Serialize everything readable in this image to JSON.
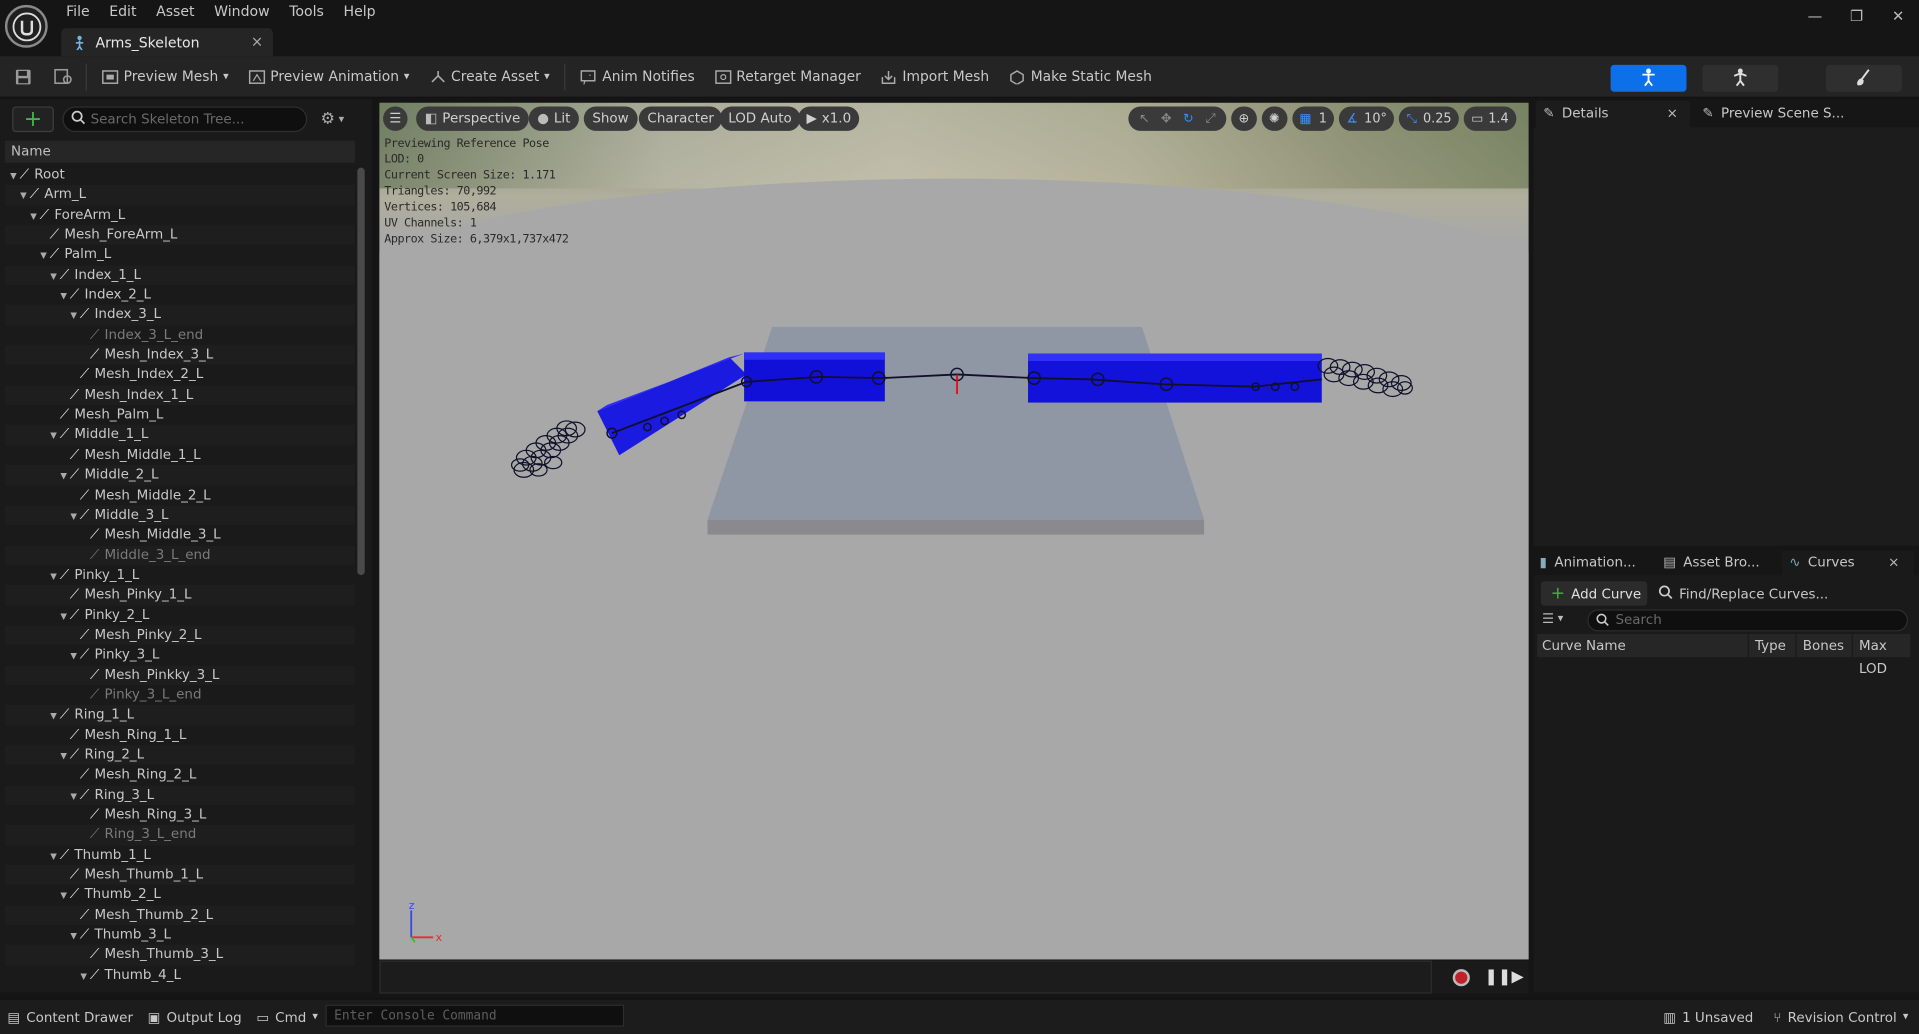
{
  "menu": [
    "File",
    "Edit",
    "Asset",
    "Window",
    "Tools",
    "Help"
  ],
  "document_tab": {
    "title": "Arms_Skeleton",
    "close": "×"
  },
  "window_controls": {
    "minimize": "—",
    "restore": "❐",
    "close": "✕"
  },
  "toolbar": {
    "preview_mesh": "Preview Mesh",
    "preview_animation": "Preview Animation",
    "create_asset": "Create Asset",
    "anim_notifies": "Anim Notifies",
    "retarget_manager": "Retarget Manager",
    "import_mesh": "Import Mesh",
    "make_static_mesh": "Make Static Mesh"
  },
  "skeleton_tree": {
    "search_placeholder": "Search Skeleton Tree...",
    "column_name": "Name",
    "bones": [
      {
        "label": "Root",
        "depth": 0,
        "expand": true,
        "dim": false
      },
      {
        "label": "Arm_L",
        "depth": 1,
        "expand": true,
        "dim": false
      },
      {
        "label": "ForeArm_L",
        "depth": 2,
        "expand": true,
        "dim": false
      },
      {
        "label": "Mesh_ForeArm_L",
        "depth": 3,
        "expand": false,
        "dim": false
      },
      {
        "label": "Palm_L",
        "depth": 3,
        "expand": true,
        "dim": false
      },
      {
        "label": "Index_1_L",
        "depth": 4,
        "expand": true,
        "dim": false
      },
      {
        "label": "Index_2_L",
        "depth": 5,
        "expand": true,
        "dim": false
      },
      {
        "label": "Index_3_L",
        "depth": 6,
        "expand": true,
        "dim": false
      },
      {
        "label": "Index_3_L_end",
        "depth": 7,
        "expand": false,
        "dim": true
      },
      {
        "label": "Mesh_Index_3_L",
        "depth": 7,
        "expand": false,
        "dim": false
      },
      {
        "label": "Mesh_Index_2_L",
        "depth": 6,
        "expand": false,
        "dim": false
      },
      {
        "label": "Mesh_Index_1_L",
        "depth": 5,
        "expand": false,
        "dim": false
      },
      {
        "label": "Mesh_Palm_L",
        "depth": 4,
        "expand": false,
        "dim": false
      },
      {
        "label": "Middle_1_L",
        "depth": 4,
        "expand": true,
        "dim": false
      },
      {
        "label": "Mesh_Middle_1_L",
        "depth": 5,
        "expand": false,
        "dim": false
      },
      {
        "label": "Middle_2_L",
        "depth": 5,
        "expand": true,
        "dim": false
      },
      {
        "label": "Mesh_Middle_2_L",
        "depth": 6,
        "expand": false,
        "dim": false
      },
      {
        "label": "Middle_3_L",
        "depth": 6,
        "expand": true,
        "dim": false
      },
      {
        "label": "Mesh_Middle_3_L",
        "depth": 7,
        "expand": false,
        "dim": false
      },
      {
        "label": "Middle_3_L_end",
        "depth": 7,
        "expand": false,
        "dim": true
      },
      {
        "label": "Pinky_1_L",
        "depth": 4,
        "expand": true,
        "dim": false
      },
      {
        "label": "Mesh_Pinky_1_L",
        "depth": 5,
        "expand": false,
        "dim": false
      },
      {
        "label": "Pinky_2_L",
        "depth": 5,
        "expand": true,
        "dim": false
      },
      {
        "label": "Mesh_Pinky_2_L",
        "depth": 6,
        "expand": false,
        "dim": false
      },
      {
        "label": "Pinky_3_L",
        "depth": 6,
        "expand": true,
        "dim": false
      },
      {
        "label": "Mesh_Pinkky_3_L",
        "depth": 7,
        "expand": false,
        "dim": false
      },
      {
        "label": "Pinky_3_L_end",
        "depth": 7,
        "expand": false,
        "dim": true
      },
      {
        "label": "Ring_1_L",
        "depth": 4,
        "expand": true,
        "dim": false
      },
      {
        "label": "Mesh_Ring_1_L",
        "depth": 5,
        "expand": false,
        "dim": false
      },
      {
        "label": "Ring_2_L",
        "depth": 5,
        "expand": true,
        "dim": false
      },
      {
        "label": "Mesh_Ring_2_L",
        "depth": 6,
        "expand": false,
        "dim": false
      },
      {
        "label": "Ring_3_L",
        "depth": 6,
        "expand": true,
        "dim": false
      },
      {
        "label": "Mesh_Ring_3_L",
        "depth": 7,
        "expand": false,
        "dim": false
      },
      {
        "label": "Ring_3_L_end",
        "depth": 7,
        "expand": false,
        "dim": true
      },
      {
        "label": "Thumb_1_L",
        "depth": 4,
        "expand": true,
        "dim": false
      },
      {
        "label": "Mesh_Thumb_1_L",
        "depth": 5,
        "expand": false,
        "dim": false
      },
      {
        "label": "Thumb_2_L",
        "depth": 5,
        "expand": true,
        "dim": false
      },
      {
        "label": "Mesh_Thumb_2_L",
        "depth": 6,
        "expand": false,
        "dim": false
      },
      {
        "label": "Thumb_3_L",
        "depth": 6,
        "expand": true,
        "dim": false
      },
      {
        "label": "Mesh_Thumb_3_L",
        "depth": 7,
        "expand": false,
        "dim": false
      },
      {
        "label": "Thumb_4_L",
        "depth": 7,
        "expand": true,
        "dim": false
      }
    ]
  },
  "viewport": {
    "perspective": "Perspective",
    "lit": "Lit",
    "show": "Show",
    "character": "Character",
    "lod": "LOD Auto",
    "play_rate": "x1.0",
    "grid_value": "1",
    "angle_snap": "10°",
    "scale_snap": "0.25",
    "camera_speed": "1.4",
    "stats": [
      "Previewing Reference Pose",
      "LOD: 0",
      "Current Screen Size: 1.171",
      "Triangles: 70,992",
      "Vertices: 105,684",
      "UV Channels: 1",
      "Approx Size: 6,379x1,737x472"
    ],
    "axis_labels": {
      "z": "z",
      "x": "x"
    }
  },
  "details": {
    "tab": "Details",
    "close": "×",
    "preview_tab": "Preview Scene S..."
  },
  "lower_panel": {
    "tabs": [
      "Animation...",
      "Asset Bro...",
      "Curves"
    ],
    "close": "×",
    "add_curve": "Add Curve",
    "find_replace": "Find/Replace Curves...",
    "search_placeholder": "Search",
    "columns": [
      "Curve Name",
      "Type",
      "Bones",
      "Max LOD"
    ]
  },
  "status": {
    "content_drawer": "Content Drawer",
    "output_log": "Output Log",
    "cmd": "Cmd",
    "console_placeholder": "Enter Console Command",
    "unsaved": "1 Unsaved",
    "revision_control": "Revision Control"
  },
  "colors": {
    "accent": "#0e70e8",
    "mesh_blue": "#1515e0",
    "add_green": "#3fb742",
    "record_red": "#c0202a"
  }
}
